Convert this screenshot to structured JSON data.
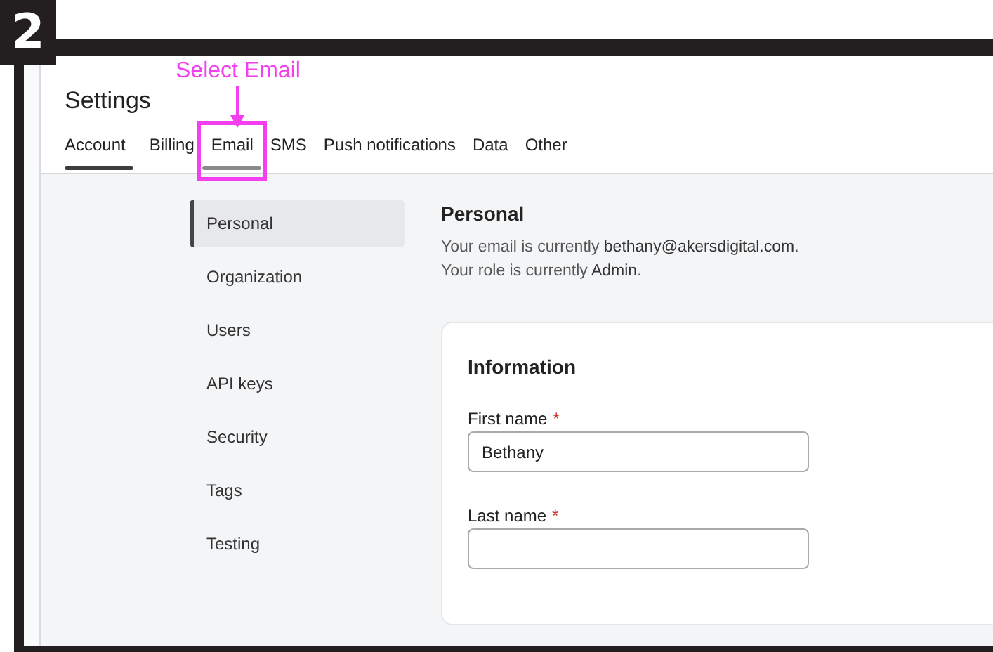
{
  "step_badge": "2",
  "annotation": {
    "text": "Select Email"
  },
  "header": {
    "title": "Settings"
  },
  "tabs": [
    {
      "label": "Account",
      "selected": true,
      "highlighted": false
    },
    {
      "label": "Billing",
      "selected": false,
      "highlighted": false
    },
    {
      "label": "Email",
      "selected": false,
      "highlighted": true
    },
    {
      "label": "SMS",
      "selected": false,
      "highlighted": false
    },
    {
      "label": "Push notifications",
      "selected": false,
      "highlighted": false
    },
    {
      "label": "Data",
      "selected": false,
      "highlighted": false
    },
    {
      "label": "Other",
      "selected": false,
      "highlighted": false
    }
  ],
  "sidebar": {
    "items": [
      {
        "label": "Personal",
        "selected": true
      },
      {
        "label": "Organization",
        "selected": false
      },
      {
        "label": "Users",
        "selected": false
      },
      {
        "label": "API keys",
        "selected": false
      },
      {
        "label": "Security",
        "selected": false
      },
      {
        "label": "Tags",
        "selected": false
      },
      {
        "label": "Testing",
        "selected": false
      }
    ]
  },
  "section": {
    "title": "Personal",
    "lines": [
      "Your email is currently **bethany@akersdigital.com**.",
      "Your role is currently **Admin**."
    ]
  },
  "card": {
    "title": "Information",
    "fields": [
      {
        "label": "First name",
        "required_mark": "*",
        "value": "Bethany"
      },
      {
        "label": "Last name",
        "required_mark": "*"
      }
    ]
  }
}
